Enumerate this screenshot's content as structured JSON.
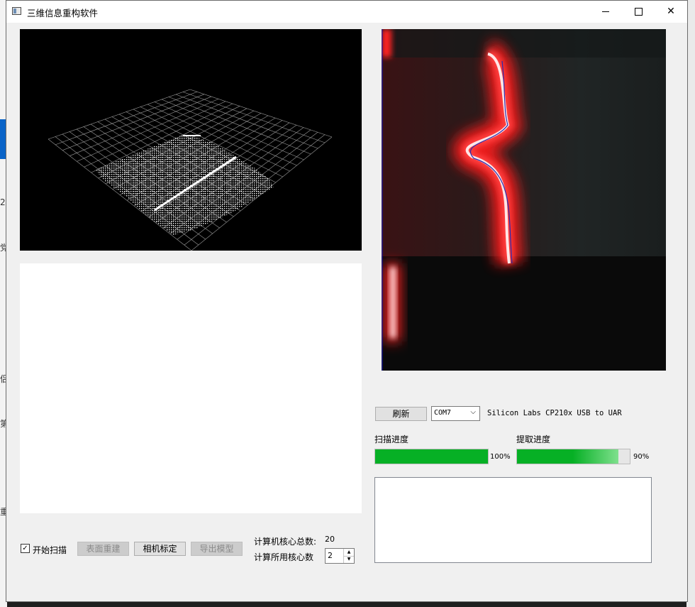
{
  "window": {
    "title": "三维信息重构软件",
    "controls": {
      "minimize": "—",
      "maximize": "☐",
      "close": "✕"
    }
  },
  "behind_window_marks": [
    "2",
    "党",
    "侣",
    "第",
    "重"
  ],
  "serial": {
    "refresh_label": "刷新",
    "port_selected": "COM7",
    "port_description": "Silicon Labs CP210x USB to UAR"
  },
  "progress": {
    "scan_label": "扫描进度",
    "scan_value": 100,
    "scan_text": "100%",
    "extract_label": "提取进度",
    "extract_value": 90,
    "extract_text": "90%"
  },
  "controls": {
    "start_scan_label": "开始扫描",
    "start_scan_checked": true,
    "surface_rebuild_label": "表面重建",
    "camera_calib_label": "相机标定",
    "export_model_label": "导出模型"
  },
  "cores": {
    "total_label": "计算机核心总数:",
    "total_value": "20",
    "used_label": "计算所用核心数",
    "used_value": "2"
  },
  "colors": {
    "progress_green": "#06b025",
    "laser_red": "#ff2020",
    "background": "#f0f0f0"
  }
}
